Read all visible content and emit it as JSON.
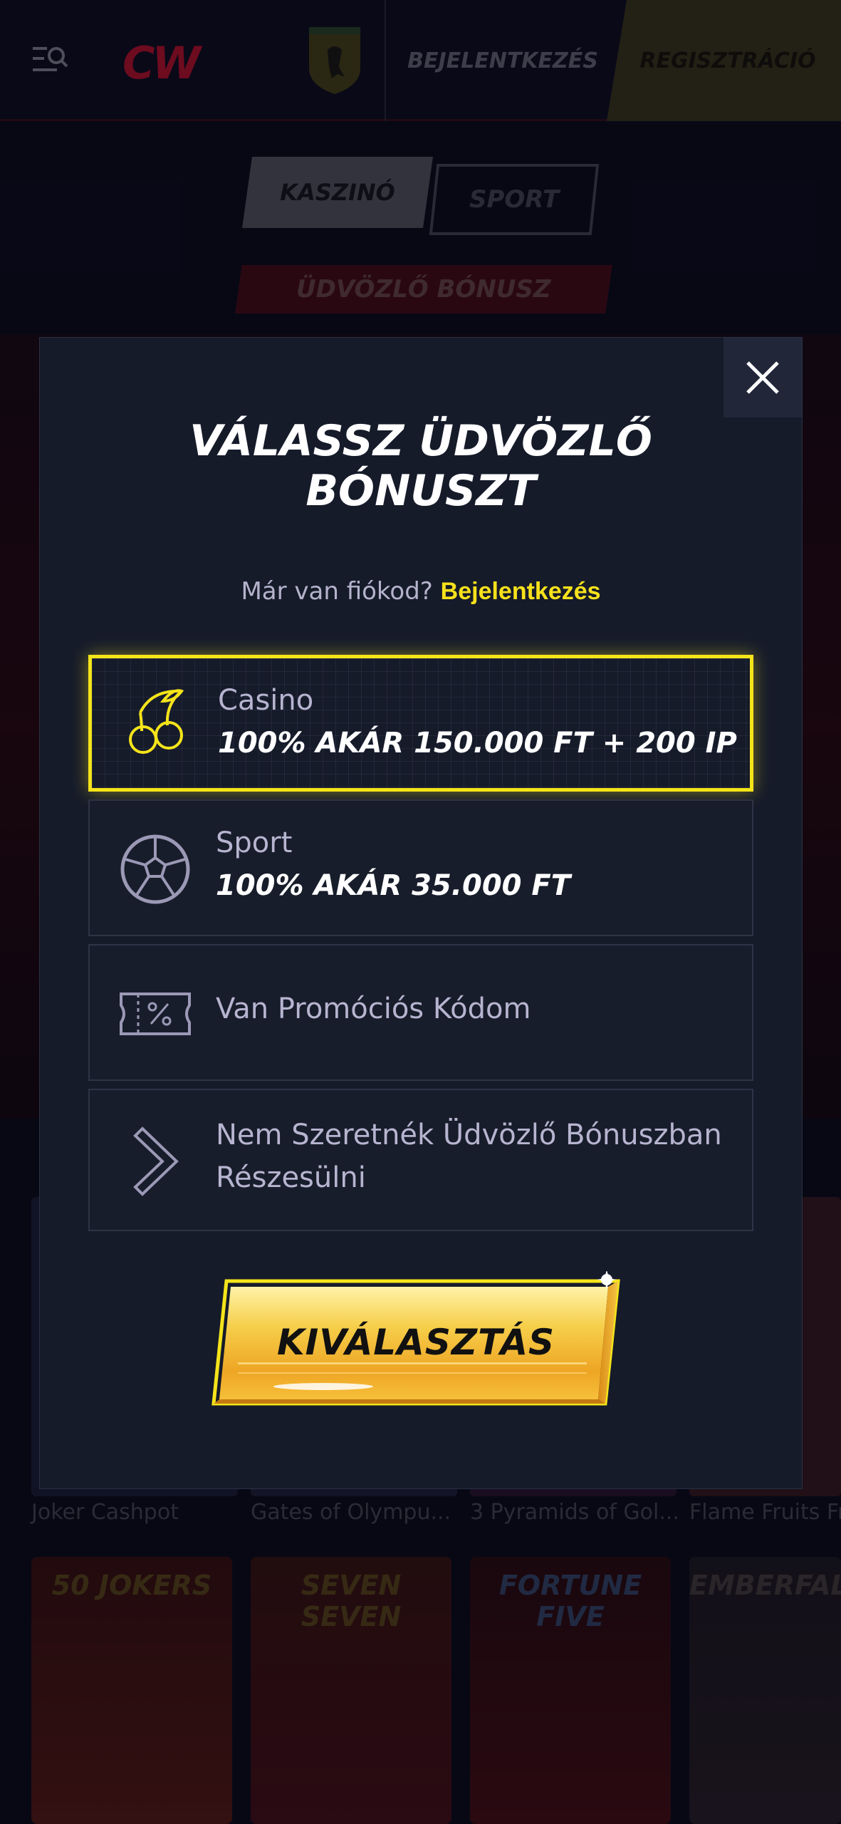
{
  "header": {
    "logo_text": "CW",
    "login_label": "BEJELENTKEZÉS",
    "register_label": "REGISZTRÁCIÓ"
  },
  "sub_tabs": {
    "casino_label": "KASZINÓ",
    "sport_label": "SPORT"
  },
  "banner": {
    "label": "ÜDVÖZLŐ BÓNUSZ"
  },
  "games": {
    "names": [
      "Joker Cashpot",
      "Gates of Olympu...",
      "3 Pyramids of Gol...",
      "Flame Fruits Fr"
    ],
    "tiles": [
      "50 JOKERS",
      "SEVEN SEVEN",
      "FORTUNE FIVE",
      "EMBERFALL"
    ]
  },
  "modal": {
    "title_line1": "VÁLASSZ ÜDVÖZLŐ",
    "title_line2": "BÓNUSZT",
    "prompt_text": "Már van fiókod?",
    "prompt_link": "Bejelentkezés",
    "options": [
      {
        "icon": "cherry-icon",
        "label": "Casino",
        "value": "100% AKÁR 150.000 FT + 200 IP",
        "selected": true
      },
      {
        "icon": "soccer-ball-icon",
        "label": "Sport",
        "value": "100% AKÁR 35.000 FT",
        "selected": false
      },
      {
        "icon": "promo-ticket-icon",
        "label": "Van Promóciós Kódom",
        "selected": false
      },
      {
        "icon": "chevron-right-icon",
        "label_line1": "Nem Szeretnék Üdvözlő Bónuszban",
        "label_line2": "Részesülni",
        "selected": false
      }
    ],
    "select_button": "KIVÁLASZTÁS",
    "accent_color": "#f5e41a"
  }
}
